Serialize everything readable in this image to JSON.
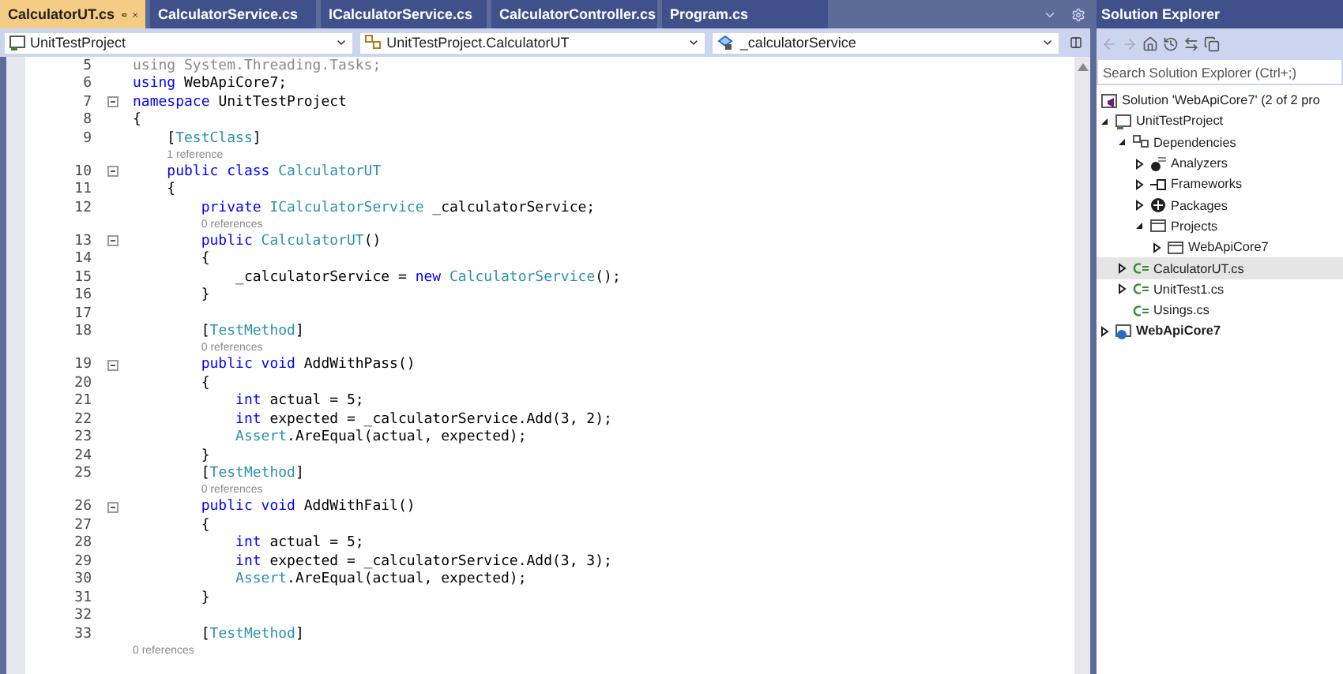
{
  "tabs": [
    {
      "label": "CalculatorUT.cs",
      "selected": true
    },
    {
      "label": "CalculatorService.cs",
      "selected": false
    },
    {
      "label": "ICalculatorService.cs",
      "selected": false
    },
    {
      "label": "CalculatorController.cs",
      "selected": false
    },
    {
      "label": "Program.cs",
      "selected": false
    }
  ],
  "nav_bar": {
    "project": "UnitTestProject",
    "type": "UnitTestProject.CalculatorUT",
    "member": "_calculatorService"
  },
  "editor": {
    "lines": [
      {
        "kind": "code",
        "number": "5",
        "fold": false,
        "tokens": [
          {
            "kind": "dim",
            "text": "using System.Threading.Tasks;"
          }
        ]
      },
      {
        "kind": "code",
        "number": "6",
        "fold": false,
        "tokens": [
          {
            "kind": "kw",
            "text": "using"
          },
          {
            "kind": "plain",
            "text": " WebApiCore7;"
          }
        ]
      },
      {
        "kind": "code",
        "number": "7",
        "fold": true,
        "tokens": [
          {
            "kind": "kw",
            "text": "namespace"
          },
          {
            "kind": "plain",
            "text": " UnitTestProject"
          }
        ]
      },
      {
        "kind": "code",
        "number": "8",
        "fold": false,
        "tokens": [
          {
            "kind": "plain",
            "text": "{"
          }
        ]
      },
      {
        "kind": "code",
        "number": "9",
        "fold": false,
        "tokens": [
          {
            "kind": "plain",
            "text": "    ["
          },
          {
            "kind": "type",
            "text": "TestClass"
          },
          {
            "kind": "plain",
            "text": "]"
          }
        ]
      },
      {
        "kind": "lens",
        "text": "1 reference"
      },
      {
        "kind": "code",
        "number": "10",
        "fold": true,
        "tokens": [
          {
            "kind": "kw",
            "text": "    public class"
          },
          {
            "kind": "type",
            "text": " CalculatorUT"
          }
        ]
      },
      {
        "kind": "code",
        "number": "11",
        "fold": false,
        "tokens": [
          {
            "kind": "plain",
            "text": "    {"
          }
        ]
      },
      {
        "kind": "code",
        "number": "12",
        "fold": false,
        "tokens": [
          {
            "kind": "kw",
            "text": "        private"
          },
          {
            "kind": "type",
            "text": " ICalculatorService"
          },
          {
            "kind": "plain",
            "text": " _calculatorService;"
          }
        ]
      },
      {
        "kind": "lens",
        "text": "0 references"
      },
      {
        "kind": "code",
        "number": "13",
        "fold": true,
        "tokens": [
          {
            "kind": "kw",
            "text": "        public"
          },
          {
            "kind": "type",
            "text": " CalculatorUT"
          },
          {
            "kind": "plain",
            "text": "()"
          }
        ]
      },
      {
        "kind": "code",
        "number": "14",
        "fold": false,
        "tokens": [
          {
            "kind": "plain",
            "text": "        {"
          }
        ]
      },
      {
        "kind": "code",
        "number": "15",
        "fold": false,
        "tokens": [
          {
            "kind": "plain",
            "text": "            _calculatorService = "
          },
          {
            "kind": "kw",
            "text": "new"
          },
          {
            "kind": "type",
            "text": " CalculatorService"
          },
          {
            "kind": "plain",
            "text": "();"
          }
        ]
      },
      {
        "kind": "code",
        "number": "16",
        "fold": false,
        "tokens": [
          {
            "kind": "plain",
            "text": "        }"
          }
        ]
      },
      {
        "kind": "code",
        "number": "17",
        "fold": false
      },
      {
        "kind": "code",
        "number": "18",
        "fold": false,
        "tokens": [
          {
            "kind": "plain",
            "text": "        ["
          },
          {
            "kind": "type",
            "text": "TestMethod"
          },
          {
            "kind": "plain",
            "text": "]"
          }
        ]
      },
      {
        "kind": "lens",
        "text": "0 references"
      },
      {
        "kind": "code",
        "number": "19",
        "fold": true,
        "tokens": [
          {
            "kind": "kw",
            "text": "        public void"
          },
          {
            "kind": "plain",
            "text": " AddWithPass()"
          }
        ]
      },
      {
        "kind": "code",
        "number": "20",
        "fold": false,
        "tokens": [
          {
            "kind": "plain",
            "text": "        {"
          }
        ]
      },
      {
        "kind": "code",
        "number": "21",
        "fold": false,
        "tokens": [
          {
            "kind": "kw",
            "text": "            int"
          },
          {
            "kind": "plain",
            "text": " actual = 5;"
          }
        ]
      },
      {
        "kind": "code",
        "number": "22",
        "fold": false,
        "tokens": [
          {
            "kind": "kw",
            "text": "            int"
          },
          {
            "kind": "plain",
            "text": " expected = _calculatorService.Add(3, 2);"
          }
        ]
      },
      {
        "kind": "code",
        "number": "23",
        "fold": false,
        "tokens": [
          {
            "kind": "type",
            "text": "            Assert"
          },
          {
            "kind": "plain",
            "text": ".AreEqual(actual, expected);"
          }
        ]
      },
      {
        "kind": "code",
        "number": "24",
        "fold": false,
        "tokens": [
          {
            "kind": "plain",
            "text": "        }"
          }
        ]
      },
      {
        "kind": "code",
        "number": "25",
        "fold": false,
        "tokens": [
          {
            "kind": "plain",
            "text": "        ["
          },
          {
            "kind": "type",
            "text": "TestMethod"
          },
          {
            "kind": "plain",
            "text": "]"
          }
        ]
      },
      {
        "kind": "lens",
        "text": "0 references"
      },
      {
        "kind": "code",
        "number": "26",
        "fold": true,
        "tokens": [
          {
            "kind": "kw",
            "text": "        public void"
          },
          {
            "kind": "plain",
            "text": " AddWithFail()"
          }
        ]
      },
      {
        "kind": "code",
        "number": "27",
        "fold": false,
        "tokens": [
          {
            "kind": "plain",
            "text": "        {"
          }
        ]
      },
      {
        "kind": "code",
        "number": "28",
        "fold": false,
        "tokens": [
          {
            "kind": "kw",
            "text": "            int"
          },
          {
            "kind": "plain",
            "text": " actual = 5;"
          }
        ]
      },
      {
        "kind": "code",
        "number": "29",
        "fold": false,
        "tokens": [
          {
            "kind": "kw",
            "text": "            int"
          },
          {
            "kind": "plain",
            "text": " expected = _calculatorService.Add(3, 3);"
          }
        ]
      },
      {
        "kind": "code",
        "number": "30",
        "fold": false,
        "tokens": [
          {
            "kind": "type",
            "text": "            Assert"
          },
          {
            "kind": "plain",
            "text": ".AreEqual(actual, expected);"
          }
        ]
      },
      {
        "kind": "code",
        "number": "31",
        "fold": false,
        "tokens": [
          {
            "kind": "plain",
            "text": "        }"
          }
        ]
      },
      {
        "kind": "code",
        "number": "32",
        "fold": false
      },
      {
        "kind": "code",
        "number": "33",
        "fold": false,
        "tokens": [
          {
            "kind": "plain",
            "text": "        ["
          },
          {
            "kind": "type",
            "text": "TestMethod"
          },
          {
            "kind": "plain",
            "text": "]"
          }
        ]
      },
      {
        "kind": "lens",
        "text": "0 references"
      }
    ]
  },
  "solution_explorer": {
    "title": "Solution Explorer",
    "search": {
      "placeholder": "Search Solution Explorer (Ctrl+;)"
    },
    "tree": [
      {
        "label": "Solution 'WebApiCore7' (2 of 2 pro",
        "kind": "solution",
        "selected": false,
        "bold": false,
        "children": [
          {
            "label": "UnitTestProject",
            "kind": "project",
            "expanded": true,
            "selected": false,
            "bold": false,
            "children": [
              {
                "label": "Dependencies",
                "kind": "dependencies",
                "expanded": true,
                "selected": false,
                "bold": false,
                "children": [
                  {
                    "label": "Analyzers",
                    "kind": "analyzers",
                    "expanded": false,
                    "selected": false,
                    "bold": false
                  },
                  {
                    "label": "Frameworks",
                    "kind": "frameworks",
                    "expanded": false,
                    "selected": false,
                    "bold": false
                  },
                  {
                    "label": "Packages",
                    "kind": "packages",
                    "expanded": false,
                    "selected": false,
                    "bold": false
                  },
                  {
                    "label": "Projects",
                    "kind": "folder",
                    "expanded": true,
                    "selected": false,
                    "bold": false,
                    "children": [
                      {
                        "label": "WebApiCore7",
                        "kind": "folder",
                        "expanded": false,
                        "selected": false,
                        "bold": false
                      }
                    ]
                  }
                ]
              },
              {
                "label": "CalculatorUT.cs",
                "kind": "csharp",
                "expanded": false,
                "selected": true,
                "bold": false
              },
              {
                "label": "UnitTest1.cs",
                "kind": "csharp",
                "expanded": false,
                "selected": false,
                "bold": false
              },
              {
                "label": "Usings.cs",
                "kind": "csharp",
                "selected": false,
                "bold": false
              }
            ]
          },
          {
            "label": "WebApiCore7",
            "kind": "webproject",
            "expanded": false,
            "selected": false,
            "bold": true
          }
        ]
      }
    ]
  }
}
